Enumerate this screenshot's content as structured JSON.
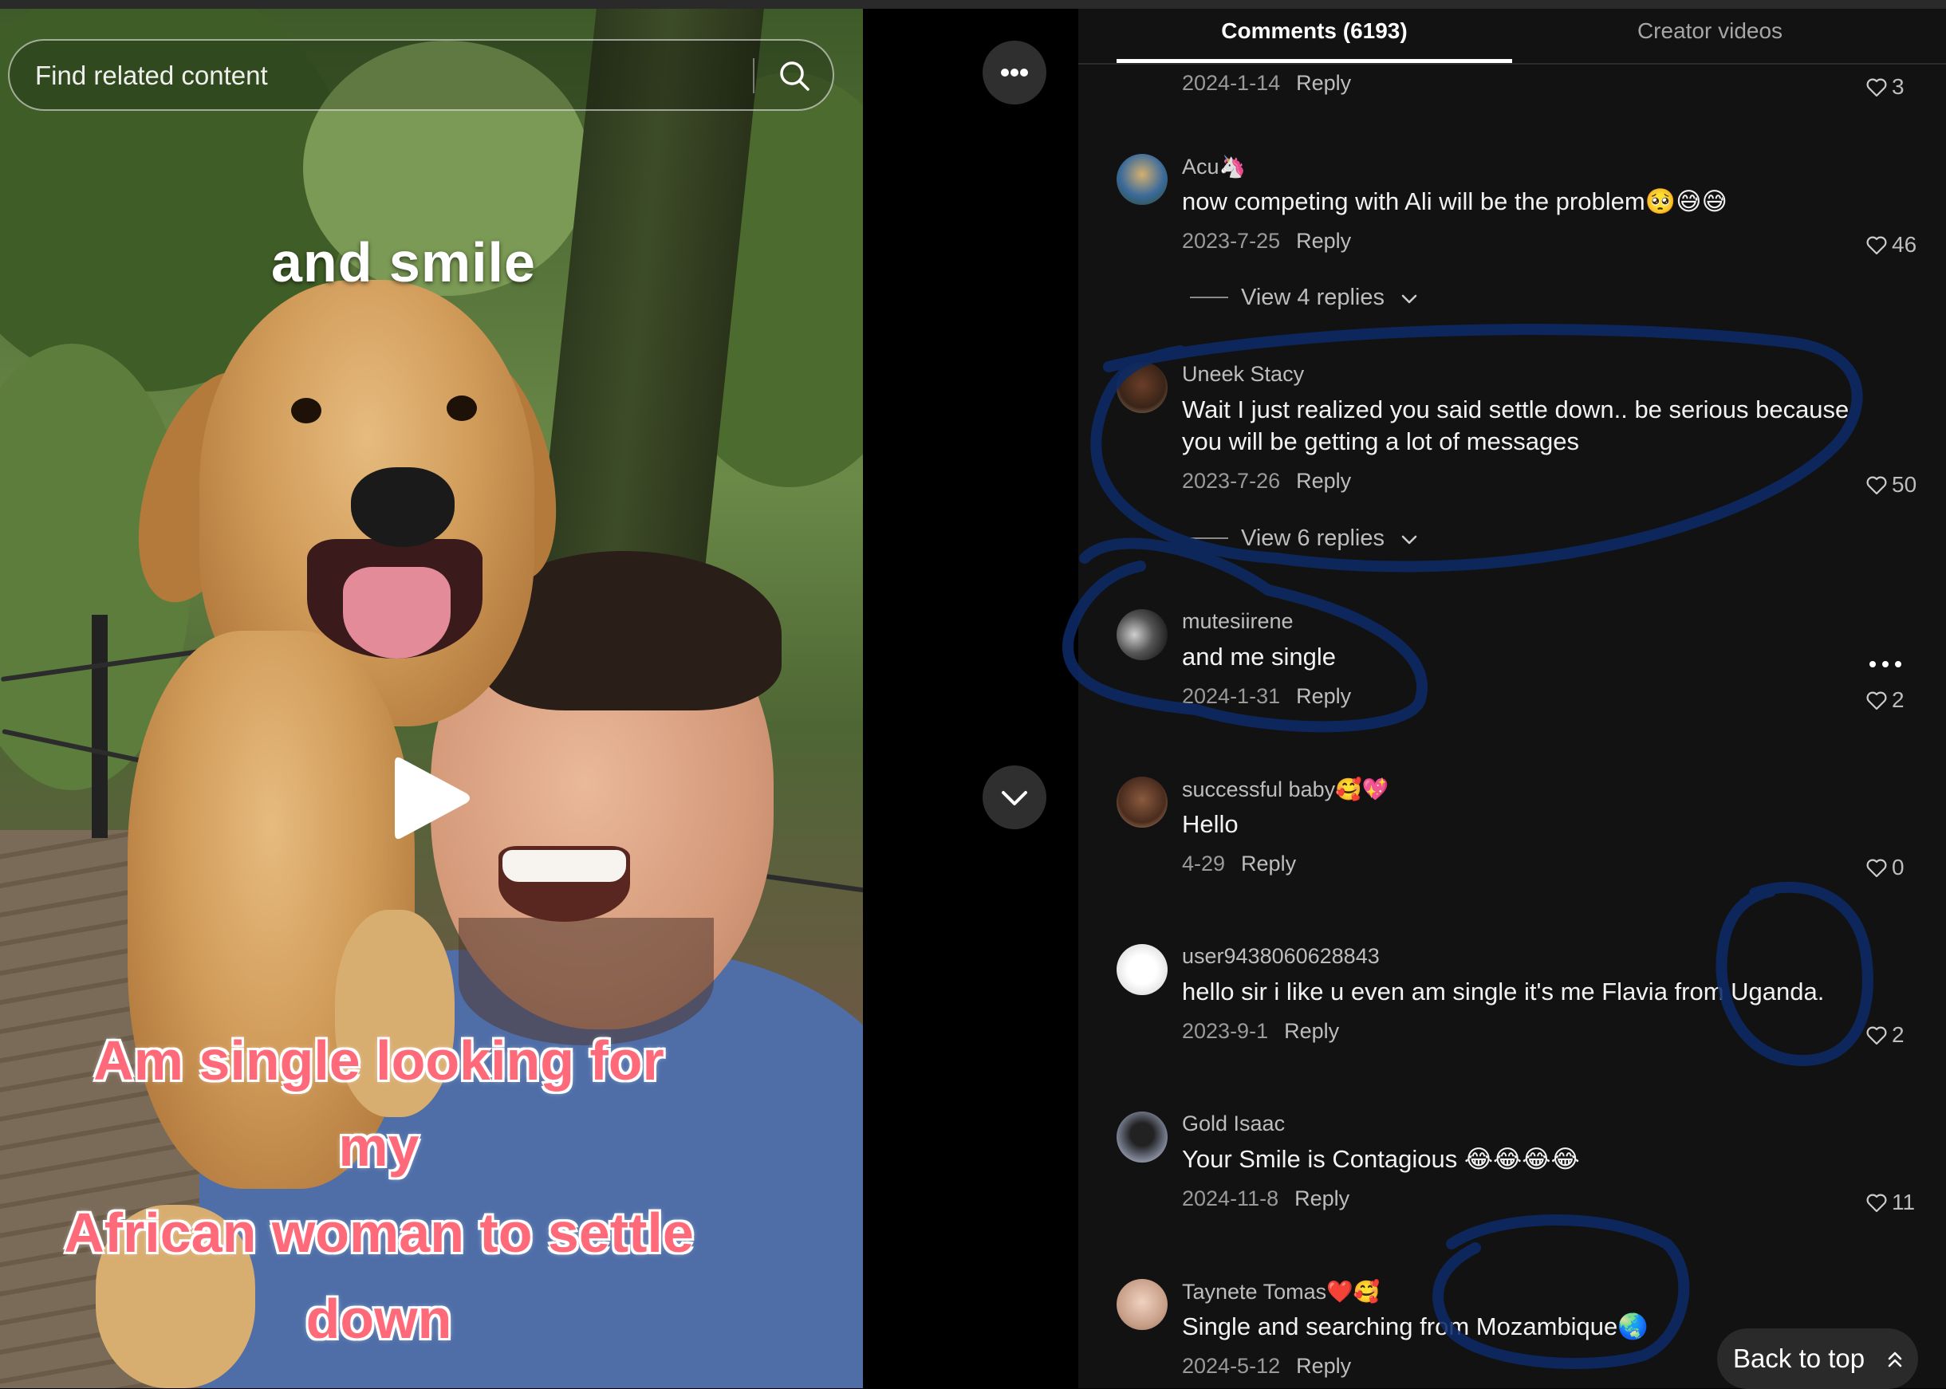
{
  "search": {
    "placeholder": "Find related content"
  },
  "video": {
    "overlay_top": "and smile",
    "overlay_bottom_lines": [
      "Am single looking for my",
      "African woman to settle",
      "down"
    ]
  },
  "tabs": [
    {
      "label": "Comments (6193)",
      "active": true
    },
    {
      "label": "Creator videos",
      "active": false
    }
  ],
  "reply_label": "Reply",
  "partial_comment": {
    "date": "2024-1-14",
    "likes": "3"
  },
  "comments": [
    {
      "username": "Acu🦄",
      "text": "now competing with Ali will be the problem🥺😅😅",
      "date": "2023-7-25",
      "likes": "46",
      "view_replies": "View 4 replies"
    },
    {
      "username": "Uneek Stacy",
      "text": "Wait I just realized you said settle down.. be serious because you will be getting a lot of messages",
      "date": "2023-7-26",
      "likes": "50",
      "view_replies": "View 6 replies"
    },
    {
      "username": "mutesiirene",
      "text": "and me single",
      "date": "2024-1-31",
      "likes": "2"
    },
    {
      "username": "successful baby🥰💖",
      "text": "Hello",
      "date": "4-29",
      "likes": "0"
    },
    {
      "username": "user9438060628843",
      "text": "hello sir i like u even am single it's me Flavia from Uganda.",
      "date": "2023-9-1",
      "likes": "2"
    },
    {
      "username": "Gold Isaac",
      "text": "Your Smile is Contagious 😂😂😂😂",
      "date": "2024-11-8",
      "likes": "11"
    },
    {
      "username": "Taynete Tomas❤️🥰",
      "text": "Single and searching from Mozambique🌏",
      "date": "2024-5-12"
    }
  ],
  "back_to_top": "Back to top",
  "icons": {
    "search": "search-icon",
    "more": "more-horizontal-icon",
    "scroll_down": "chevron-down-icon",
    "like": "heart-outline-icon",
    "play": "play-icon",
    "back_to_top": "double-chevron-up-icon"
  },
  "colors": {
    "panel_bg": "#121212",
    "accent_text": "#ff6a7a",
    "annotation_ink": "#0d2a66"
  }
}
